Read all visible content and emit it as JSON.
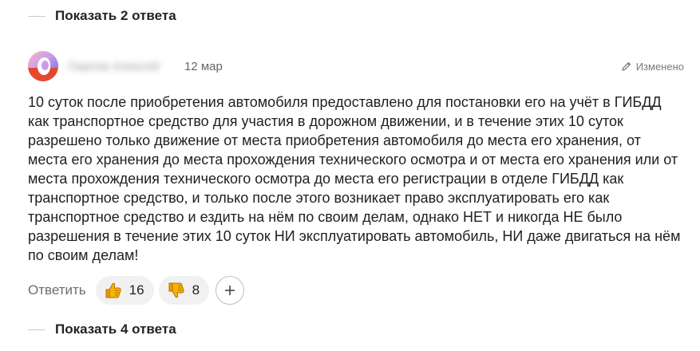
{
  "replies_top": {
    "label": "Показать 2 ответа"
  },
  "comment": {
    "author": "Павлов Алексей",
    "date": "12 мар",
    "edited_label": "Изменено",
    "text": "10 суток после приобретения автомобиля предоставлено для постановки его на учёт в ГИБДД как транспортное средство для участия в дорожном движении, и в течение этих 10 суток разрешено только движение от места приобретения автомобиля до места его хранения, от места его хранения до места прохождения технического осмотра и от места его хранения или от места прохождения технического осмотра до места его регистрации в отделе ГИБДД как транспортное средство, и только после этого возникает право эксплуатировать его как транспортное средство и ездить на нём по своим делам, однако НЕТ и никогда НЕ было разрешения в течение этих 10 суток НИ эксплуатировать автомобиль, НИ даже двигаться на нём по своим делам!",
    "reply_label": "Ответить",
    "reactions": [
      {
        "icon": "thumbs-up-icon",
        "count": "16"
      },
      {
        "icon": "thumbs-down-icon",
        "count": "8"
      }
    ],
    "add_reaction_icon": "plus-icon"
  },
  "replies_bottom": {
    "label": "Показать 4 ответа"
  },
  "colors": {
    "text": "#1f1f1f",
    "muted": "#6d6d6d",
    "reaction_bg": "#f1f1f1",
    "emoji_yellow": "#f4b400"
  }
}
